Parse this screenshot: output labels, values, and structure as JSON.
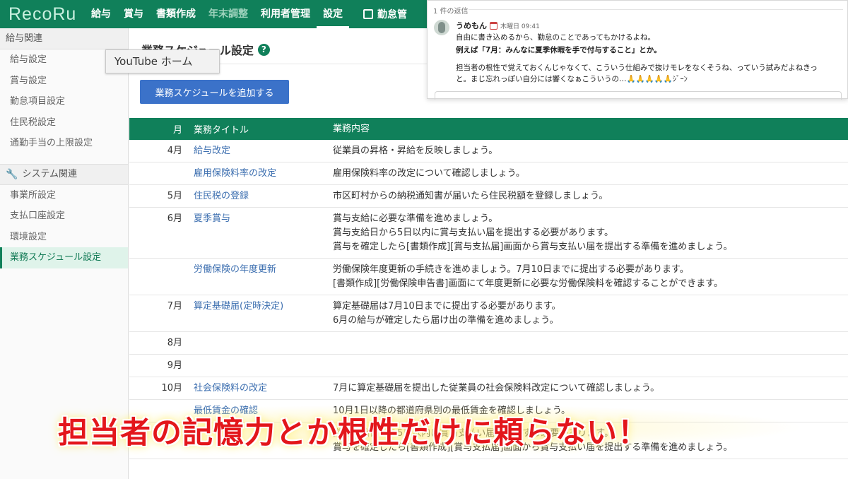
{
  "app": {
    "logo": "RecoRu",
    "nav": [
      {
        "label": "給与",
        "state": "normal"
      },
      {
        "label": "賞与",
        "state": "normal"
      },
      {
        "label": "書類作成",
        "state": "normal"
      },
      {
        "label": "年末調整",
        "state": "muted"
      },
      {
        "label": "利用者管理",
        "state": "normal"
      },
      {
        "label": "設定",
        "state": "active"
      }
    ],
    "nav_external": "勤怠管"
  },
  "sidebar": {
    "section1_title": "給与関連",
    "section1_items": [
      "給与設定",
      "賞与設定",
      "勤怠項目設定",
      "住民税設定",
      "通勤手当の上限設定"
    ],
    "section2_title": "システム関連",
    "section2_items": [
      "事業所設定",
      "支払口座設定",
      "環境設定",
      "業務スケジュール設定"
    ],
    "active_item": "業務スケジュール設定"
  },
  "tooltip": "YouTube ホーム",
  "main": {
    "title": "業務スケジュール設定",
    "help_glyph": "?",
    "add_button": "業務スケジュールを追加する",
    "table": {
      "headers": {
        "month": "月",
        "title": "業務タイトル",
        "desc": "業務内容"
      },
      "rows": [
        {
          "month": "4月",
          "title": "給与改定",
          "desc": [
            "従業員の昇格・昇給を反映しましょう。"
          ]
        },
        {
          "month": "",
          "title": "雇用保険料率の改定",
          "desc": [
            "雇用保険料率の改定について確認しましょう。"
          ]
        },
        {
          "month": "5月",
          "title": "住民税の登録",
          "desc": [
            "市区町村からの納税通知書が届いたら住民税額を登録しましょう。"
          ]
        },
        {
          "month": "6月",
          "title": "夏季賞与",
          "desc": [
            "賞与支給に必要な準備を進めましょう。",
            "賞与支給日から5日以内に賞与支払い届を提出する必要があります。",
            "賞与を確定したら[書類作成][賞与支払届]画面から賞与支払い届を提出する準備を進めましょう。"
          ]
        },
        {
          "month": "",
          "title": "労働保険の年度更新",
          "desc": [
            "労働保険年度更新の手続きを進めましょう。7月10日までに提出する必要があります。",
            "[書類作成][労働保険申告書]画面にて年度更新に必要な労働保険料を確認することができます。"
          ]
        },
        {
          "month": "7月",
          "title": "算定基礎届(定時決定)",
          "desc": [
            "算定基礎届は7月10日までに提出する必要があります。",
            "6月の給与が確定したら届け出の準備を進めましょう。"
          ]
        },
        {
          "month": "8月",
          "title": "",
          "desc": []
        },
        {
          "month": "9月",
          "title": "",
          "desc": []
        },
        {
          "month": "10月",
          "title": "社会保険料の改定",
          "desc": [
            "7月に算定基礎届を提出した従業員の社会保険料改定について確認しましょう。"
          ]
        },
        {
          "month": "",
          "title": "最低賃金の確認",
          "desc": [
            "10月1日以降の都道府県別の最低賃金を確認しましょう。"
          ]
        },
        {
          "month": "",
          "title": "",
          "desc": [
            "賞与支給日から5日以内に賞与支払い届を提出する必要があります。",
            "賞与を確定したら[書類作成][賞与支払届]画面から賞与支払い届を提出する準備を進めましょう。"
          ]
        }
      ]
    }
  },
  "chat": {
    "reply_count": "1 件の返信",
    "author": "うめもん",
    "time": "木曜日 09:41",
    "lines": [
      {
        "text": "自由に書き込めるから、勤怠のことであってもかけるよね。",
        "bold": false
      },
      {
        "text": "例えば「7月：みんなに夏季休暇を手で付与すること」とか。",
        "bold": true
      },
      {
        "text": "担当者の根性で覚えておくんじゃなくて、こういう仕組みで抜けモレをなくそうね、っていう試みだよねきっ",
        "bold": false
      },
      {
        "text": "と。まじ忘れっぽい自分には響くなぁこういうの…🙏🙏🙏🙏🙏ｼﾞｰﾝ",
        "bold": false
      }
    ]
  },
  "caption": "担当者の記憶力とか根性だけに頼らない！",
  "colors": {
    "brand_green": "#10805a",
    "button_blue": "#3b72c9",
    "link_blue": "#3d6fb0",
    "caption_red": "#e3161b"
  }
}
